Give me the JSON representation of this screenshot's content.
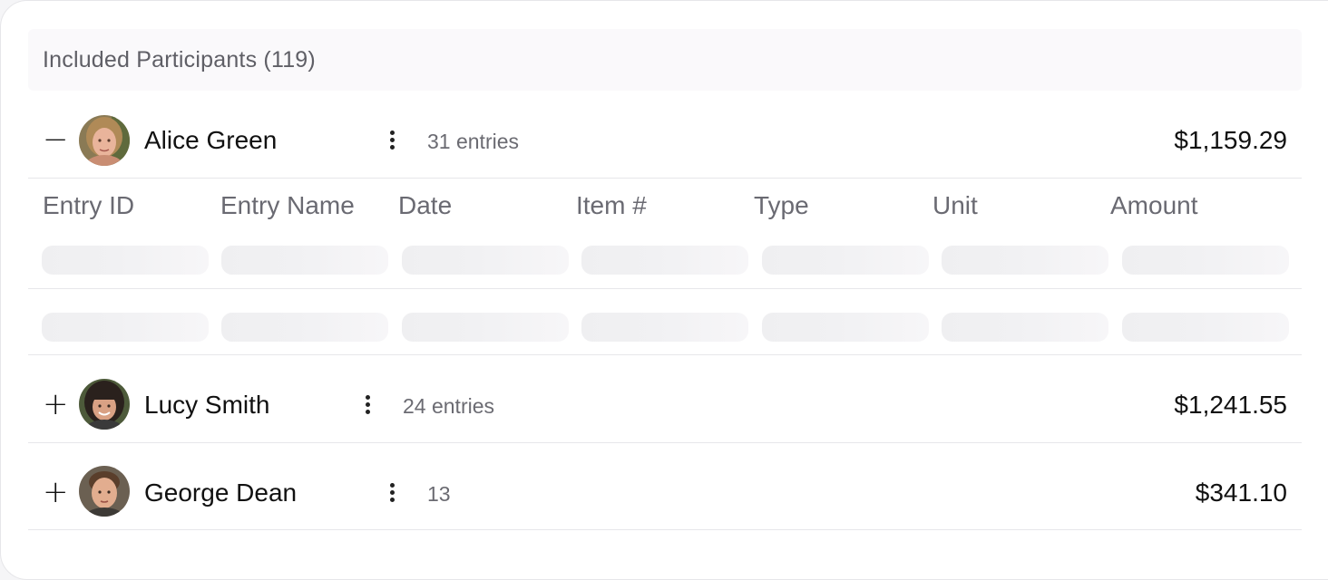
{
  "header": {
    "title": "Included Participants (119)"
  },
  "columns": [
    "Entry ID",
    "Entry Name",
    "Date",
    "Item #",
    "Type",
    "Unit",
    "Amount"
  ],
  "participants": [
    {
      "toggle": "−",
      "name": "Alice Green",
      "entries": "31 entries",
      "amount": "$1,159.29",
      "expanded": true
    },
    {
      "toggle": "+",
      "name": "Lucy Smith",
      "entries": "24 entries",
      "amount": "$1,241.55",
      "expanded": false
    },
    {
      "toggle": "+",
      "name": "George Dean",
      "entries": "13",
      "amount": "$341.10",
      "expanded": false
    }
  ],
  "loading_rows": 2,
  "colors": {
    "header_bg": "#faf9fb",
    "divider": "#e7e7ea",
    "muted_text": "#6b6b72",
    "skeleton": "#efeff1"
  },
  "icons": {
    "collapse": "minus-icon",
    "expand": "plus-icon",
    "menu": "more-vertical-icon"
  }
}
